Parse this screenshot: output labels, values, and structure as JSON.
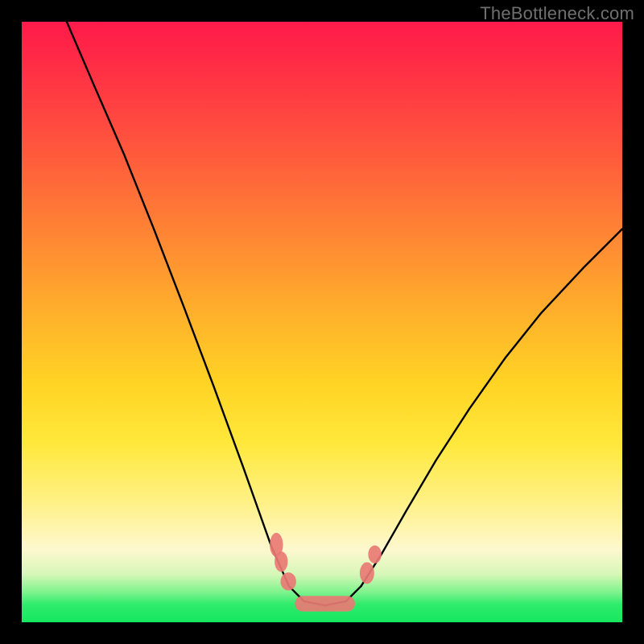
{
  "watermark": "TheBottleneck.com",
  "chart_data": {
    "type": "line",
    "title": "",
    "xlabel": "",
    "ylabel": "",
    "xlim": [
      0,
      1
    ],
    "ylim": [
      0,
      1
    ],
    "series": [
      {
        "name": "left-branch",
        "x": [
          0.075,
          0.12,
          0.17,
          0.22,
          0.27,
          0.32,
          0.37,
          0.415,
          0.445
        ],
        "y": [
          1.0,
          0.895,
          0.78,
          0.655,
          0.525,
          0.392,
          0.255,
          0.128,
          0.06
        ]
      },
      {
        "name": "right-branch",
        "x": [
          0.565,
          0.6,
          0.64,
          0.69,
          0.745,
          0.805,
          0.865,
          0.935,
          1.0
        ],
        "y": [
          0.06,
          0.115,
          0.185,
          0.27,
          0.355,
          0.44,
          0.515,
          0.59,
          0.655
        ]
      },
      {
        "name": "valley-floor",
        "x": [
          0.445,
          0.47,
          0.505,
          0.54,
          0.565
        ],
        "y": [
          0.06,
          0.035,
          0.028,
          0.035,
          0.06
        ]
      }
    ],
    "markers": [
      {
        "shape": "ellipse",
        "cx": 0.424,
        "cy": 0.129,
        "rx": 0.011,
        "ry": 0.02
      },
      {
        "shape": "ellipse",
        "cx": 0.432,
        "cy": 0.101,
        "rx": 0.011,
        "ry": 0.017
      },
      {
        "shape": "ellipse",
        "cx": 0.444,
        "cy": 0.068,
        "rx": 0.013,
        "ry": 0.015
      },
      {
        "shape": "ellipse",
        "cx": 0.575,
        "cy": 0.082,
        "rx": 0.012,
        "ry": 0.018
      },
      {
        "shape": "ellipse",
        "cx": 0.588,
        "cy": 0.113,
        "rx": 0.011,
        "ry": 0.015
      },
      {
        "shape": "pill",
        "cx": 0.505,
        "cy": 0.031,
        "rx": 0.05,
        "ry": 0.013
      }
    ],
    "gradient_stops": [
      {
        "pos": 0.0,
        "color": "#ff1a4a"
      },
      {
        "pos": 0.5,
        "color": "#ffc028"
      },
      {
        "pos": 0.88,
        "color": "#fdf8cf"
      },
      {
        "pos": 1.0,
        "color": "#16e75f"
      }
    ]
  }
}
